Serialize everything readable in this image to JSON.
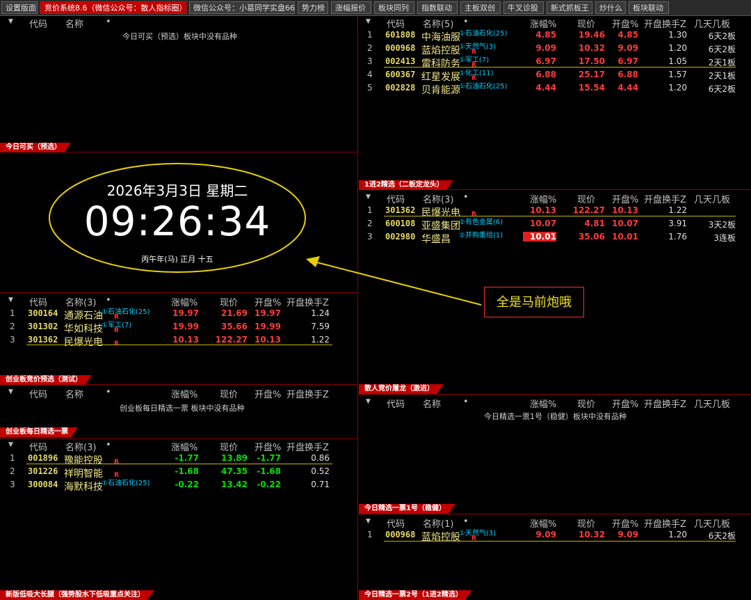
{
  "tabs": [
    "设置版面",
    "竞价系统8.6（微信公众号：散人指标圈）",
    "微信公众号：小葛同学实盘66",
    "势力榜",
    "涨幅报价",
    "板块同列",
    "指数联动",
    "主板双创",
    "牛叉诊股",
    "新式抓板王",
    "炒什么",
    "板块联动"
  ],
  "headers": {
    "code": "代码",
    "name": "名称",
    "change": "涨幅%",
    "price": "现价",
    "open": "开盘%",
    "turnover": "开盘换手Z",
    "streak": "几天几板",
    "dot": "•"
  },
  "panels": {
    "tl": {
      "title": "今日可买（预选）",
      "count": "",
      "empty": "今日可买（预选）板块中没有品种"
    },
    "clock": {
      "date": "2026年3月3日 星期二",
      "time": "09:26:34",
      "lunar": "丙午年(马) 正月 十五"
    },
    "cy": {
      "title": "创业板竞价预选（测试）",
      "count": "(3)",
      "rows": [
        {
          "idx": "1",
          "code": "300164",
          "name": "通源石油",
          "tag": "①石油石化(25)",
          "change": "19.97",
          "price": "21.69",
          "open": "19.97",
          "turnover": "1.24",
          "color": "red"
        },
        {
          "idx": "2",
          "code": "301302",
          "name": "华如科技",
          "tag": "①军工(7)",
          "change": "19.99",
          "price": "35.66",
          "open": "19.99",
          "turnover": "7.59",
          "color": "red"
        },
        {
          "idx": "3",
          "code": "301362",
          "name": "民爆光电",
          "tag": "",
          "change": "10.13",
          "price": "122.27",
          "open": "10.13",
          "turnover": "1.22",
          "color": "red"
        }
      ]
    },
    "cyd": {
      "title": "创业板每日精选一票",
      "count": "",
      "empty": "创业板每日精选一票 板块中没有品种"
    },
    "xd": {
      "title": "新版低吸大长腿（强势股水下低吸重点关注）",
      "count": "(3)",
      "rows": [
        {
          "idx": "1",
          "code": "001896",
          "name": "豫能控股",
          "tag": "",
          "change": "-1.77",
          "price": "13.89",
          "open": "-1.77",
          "turnover": "0.86",
          "color": "grn"
        },
        {
          "idx": "2",
          "code": "301226",
          "name": "祥明智能",
          "tag": "",
          "change": "-1.68",
          "price": "47.35",
          "open": "-1.68",
          "turnover": "0.52",
          "color": "grn"
        },
        {
          "idx": "3",
          "code": "300084",
          "name": "海默科技",
          "tag": "①石油石化(25)",
          "change": "-0.22",
          "price": "13.42",
          "open": "-0.22",
          "turnover": "0.71",
          "color": "grn"
        }
      ]
    },
    "tr": {
      "title": "1进2精选（二板定龙头）",
      "count": "(5)",
      "rows": [
        {
          "idx": "1",
          "code": "601808",
          "name": "中海油服",
          "tag": "①石油石化(25)",
          "change": "4.85",
          "price": "19.46",
          "open": "4.85",
          "turnover": "1.30",
          "streak": "6天2板",
          "color": "red",
          "r": false
        },
        {
          "idx": "2",
          "code": "000968",
          "name": "蓝焰控股",
          "tag": "①天然气(3)",
          "change": "9.09",
          "price": "10.32",
          "open": "9.09",
          "turnover": "1.20",
          "streak": "6天2板",
          "color": "red",
          "r": true
        },
        {
          "idx": "3",
          "code": "002413",
          "name": "雷科防务",
          "tag": "①军工(7)",
          "change": "6.97",
          "price": "17.50",
          "open": "6.97",
          "turnover": "1.05",
          "streak": "2天1板",
          "color": "red",
          "r": true
        },
        {
          "idx": "4",
          "code": "600367",
          "name": "红星发展",
          "tag": "①化工(11)",
          "change": "6.88",
          "price": "25.17",
          "open": "6.88",
          "turnover": "1.57",
          "streak": "2天1板",
          "color": "red",
          "r": true
        },
        {
          "idx": "5",
          "code": "002828",
          "name": "贝肯能源",
          "tag": "①石油石化(25)",
          "change": "4.44",
          "price": "15.54",
          "open": "4.44",
          "turnover": "1.20",
          "streak": "6天2板",
          "color": "red",
          "r": false
        }
      ]
    },
    "sr": {
      "title": "散人竞价屠龙（激进）",
      "count": "(3)",
      "rows": [
        {
          "idx": "1",
          "code": "301362",
          "name": "民爆光电",
          "tag": "",
          "change": "10.13",
          "price": "122.27",
          "open": "10.13",
          "turnover": "1.22",
          "streak": "",
          "color": "red"
        },
        {
          "idx": "2",
          "code": "600108",
          "name": "亚盛集团",
          "tag": "②有色金属(6)",
          "change": "10.07",
          "price": "4.81",
          "open": "10.07",
          "turnover": "3.91",
          "streak": "3天2板",
          "color": "red"
        },
        {
          "idx": "3",
          "code": "002980",
          "name": "华盛昌",
          "tag": "②并购重组(1)",
          "change": "10.01",
          "price": "35.06",
          "open": "10.01",
          "turnover": "1.76",
          "streak": "3连板",
          "color": "red"
        }
      ]
    },
    "j1": {
      "title": "今日精选一票1号（稳健）",
      "count": "",
      "empty": "今日精选一票1号（稳健）板块中没有品种"
    },
    "j2": {
      "title": "今日精选一票2号（1进2精选）",
      "count": "(1)",
      "rows": [
        {
          "idx": "1",
          "code": "000968",
          "name": "蓝焰控股",
          "tag": "①天然气(3)",
          "change": "9.09",
          "price": "10.32",
          "open": "9.09",
          "turnover": "1.20",
          "streak": "6天2板",
          "color": "red"
        }
      ]
    }
  },
  "annotation": "全是马前炮哦",
  "colors": {
    "accent": "#c00000",
    "up": "#ff3b3b",
    "down": "#00e000",
    "code": "#e6d96a",
    "tag": "#00d0ff",
    "ellipse": "#e8d000"
  }
}
